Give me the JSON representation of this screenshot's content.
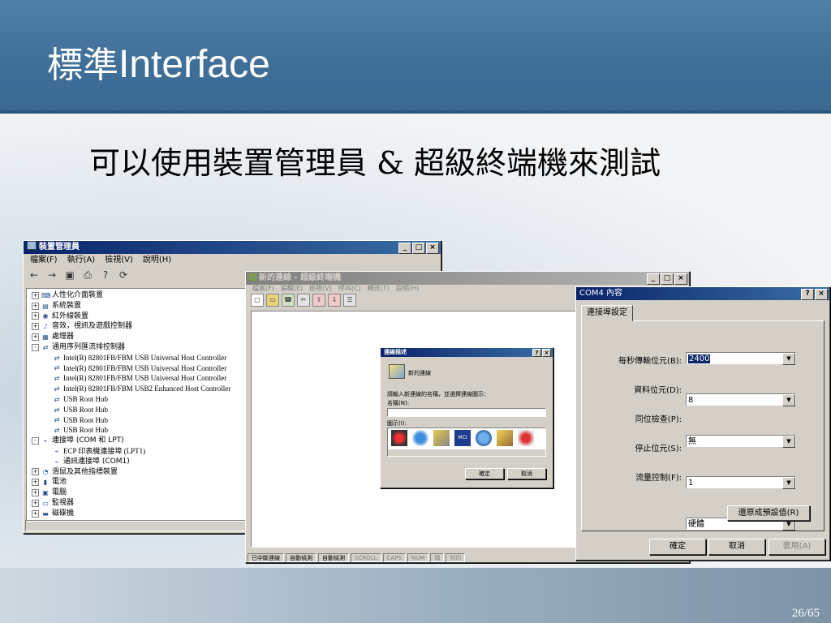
{
  "slide": {
    "title_cjk": "標準",
    "title_latin": "Interface",
    "subtitle": "可以使用裝置管理員 & 超級終端機來測試",
    "page_number": "26/65"
  },
  "device_manager": {
    "title": "裝置管理員",
    "menus": [
      "檔案(F)",
      "執行(A)",
      "檢視(V)",
      "說明(H)"
    ],
    "tree": [
      {
        "label": "人性化介面裝置",
        "expander": "+",
        "indent": 0,
        "icon": "hid"
      },
      {
        "label": "系統裝置",
        "expander": "+",
        "indent": 0,
        "icon": "system"
      },
      {
        "label": "紅外線裝置",
        "expander": "+",
        "indent": 0,
        "icon": "infrared"
      },
      {
        "label": "音效，視訊及遊戲控制器",
        "expander": "+",
        "indent": 0,
        "icon": "sound"
      },
      {
        "label": "處理器",
        "expander": "+",
        "indent": 0,
        "icon": "cpu"
      },
      {
        "label": "通用序列匯流排控制器",
        "expander": "-",
        "indent": 0,
        "icon": "usb"
      },
      {
        "label": "Intel(R) 82801FB/FBM USB Universal Host Controller",
        "expander": "",
        "indent": 1,
        "icon": "usb"
      },
      {
        "label": "Intel(R) 82801FB/FBM USB Universal Host Controller",
        "expander": "",
        "indent": 1,
        "icon": "usb"
      },
      {
        "label": "Intel(R) 82801FB/FBM USB Universal Host Controller",
        "expander": "",
        "indent": 1,
        "icon": "usb"
      },
      {
        "label": "Intel(R) 82801FB/FBM USB2 Enhanced Host Controller",
        "expander": "",
        "indent": 1,
        "icon": "usb"
      },
      {
        "label": "USB Root Hub",
        "expander": "",
        "indent": 1,
        "icon": "usb"
      },
      {
        "label": "USB Root Hub",
        "expander": "",
        "indent": 1,
        "icon": "usb"
      },
      {
        "label": "USB Root Hub",
        "expander": "",
        "indent": 1,
        "icon": "usb"
      },
      {
        "label": "USB Root Hub",
        "expander": "",
        "indent": 1,
        "icon": "usb"
      },
      {
        "label": "連接埠 (COM 和 LPT)",
        "expander": "-",
        "indent": 0,
        "icon": "port"
      },
      {
        "label": "ECP 印表機連接埠 (LPT1)",
        "expander": "",
        "indent": 1,
        "icon": "port"
      },
      {
        "label": "通訊連接埠 (COM1)",
        "expander": "",
        "indent": 1,
        "icon": "port"
      },
      {
        "label": "滑鼠及其他指標裝置",
        "expander": "+",
        "indent": 0,
        "icon": "mouse"
      },
      {
        "label": "電池",
        "expander": "+",
        "indent": 0,
        "icon": "battery"
      },
      {
        "label": "電腦",
        "expander": "+",
        "indent": 0,
        "icon": "computer"
      },
      {
        "label": "監視器",
        "expander": "+",
        "indent": 0,
        "icon": "monitor"
      },
      {
        "label": "磁碟機",
        "expander": "+",
        "indent": 0,
        "icon": "disk"
      }
    ]
  },
  "hyperterminal": {
    "title": "新的連線 - 超級終端機",
    "menus": [
      "檔案(F)",
      "編輯(E)",
      "檢視(V)",
      "呼叫(C)",
      "轉送(T)",
      "說明(H)"
    ],
    "status_items": [
      "已中斷連線",
      "自動偵測",
      "自動偵測",
      "SCROLL",
      "CAPS",
      "NUM",
      "擷",
      "列印"
    ]
  },
  "connection_dialog": {
    "title": "連線描述",
    "heading": "新的連線",
    "prompt": "請輸入新連線的名稱，並選擇連線圖示：",
    "name_label": "名稱(N):",
    "name_value": "",
    "icon_label": "圖示(I):",
    "ok_label": "確定",
    "cancel_label": "取消"
  },
  "com4_dialog": {
    "title": "COM4 內容",
    "tab_label": "連接埠設定",
    "fields": [
      {
        "label": "每秒傳輸位元(B):",
        "value": "2400",
        "selected": true
      },
      {
        "label": "資料位元(D):",
        "value": "8",
        "selected": false
      },
      {
        "label": "同位檢查(P):",
        "value": "無",
        "selected": false
      },
      {
        "label": "停止位元(S):",
        "value": "1",
        "selected": false
      },
      {
        "label": "流量控制(F):",
        "value": "硬體",
        "selected": false
      }
    ],
    "restore_label": "還原成預設值(R)",
    "ok_label": "確定",
    "cancel_label": "取消",
    "apply_label": "套用(A)"
  }
}
